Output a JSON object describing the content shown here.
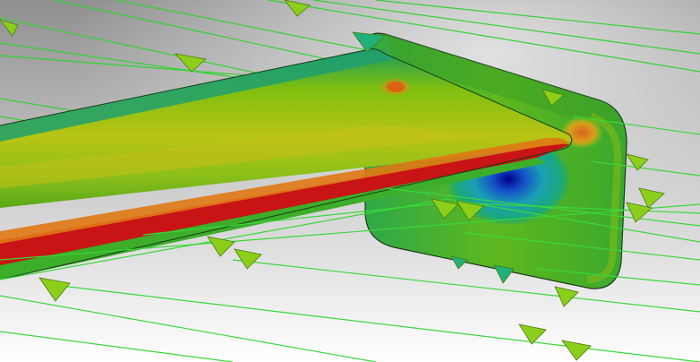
{
  "scene": {
    "kind": "cfd-flow-simulation-render",
    "background_top": "#9a9a9a",
    "background_bottom": "#ffffff",
    "streamline_color": "#2fd12f",
    "arrow_color": "#8ccf1a",
    "contour_colors": [
      "#0000a8",
      "#1a64d0",
      "#1aa0a8",
      "#18a060",
      "#3cb428",
      "#8cc814",
      "#c8c814",
      "#e0a014",
      "#e05a14",
      "#c81414"
    ],
    "labels": []
  }
}
